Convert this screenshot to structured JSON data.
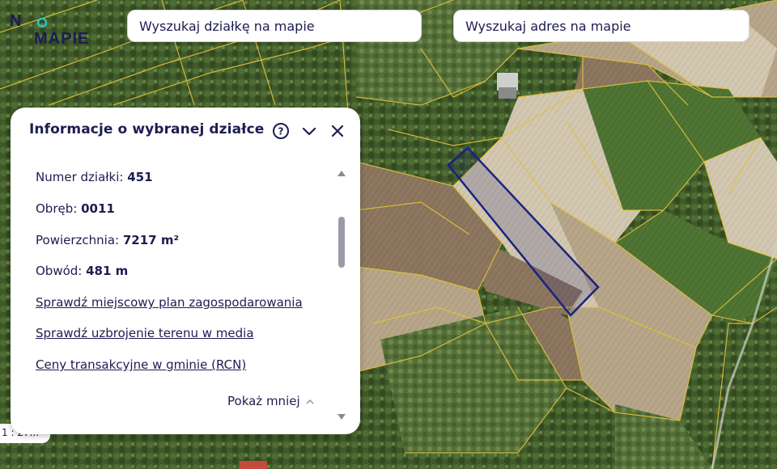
{
  "logo": {
    "text_left": "N",
    "text_rest": "MAPIE",
    "alt": "NA MAPIE"
  },
  "search": {
    "plot_placeholder": "Wyszukaj działkę na mapie",
    "address_placeholder": "Wyszukaj adres na mapie"
  },
  "scale": {
    "label": "1 : 27..."
  },
  "panel": {
    "title": "Informacje o wybranej działce",
    "icons": [
      "help-icon",
      "chevron-down-icon",
      "close-icon"
    ],
    "rows": [
      {
        "label": "Numer działki: ",
        "value": "451"
      },
      {
        "label": "Obręb: ",
        "value": "0011"
      },
      {
        "label": "Powierzchnia: ",
        "value": "7217 m²"
      },
      {
        "label": "Obwód: ",
        "value": "481 m"
      }
    ],
    "links": [
      "Sprawdź miejscowy plan zagospodarowania",
      "Sprawdź uzbrojenie terenu w media",
      "Ceny transakcyjne w gminie (RCN)"
    ],
    "show_less": "Pokaż mniej"
  },
  "colors": {
    "brand": "#1d1d52",
    "parcel_lines": "#e2c23a",
    "selected_parcel": "#1a2380"
  }
}
